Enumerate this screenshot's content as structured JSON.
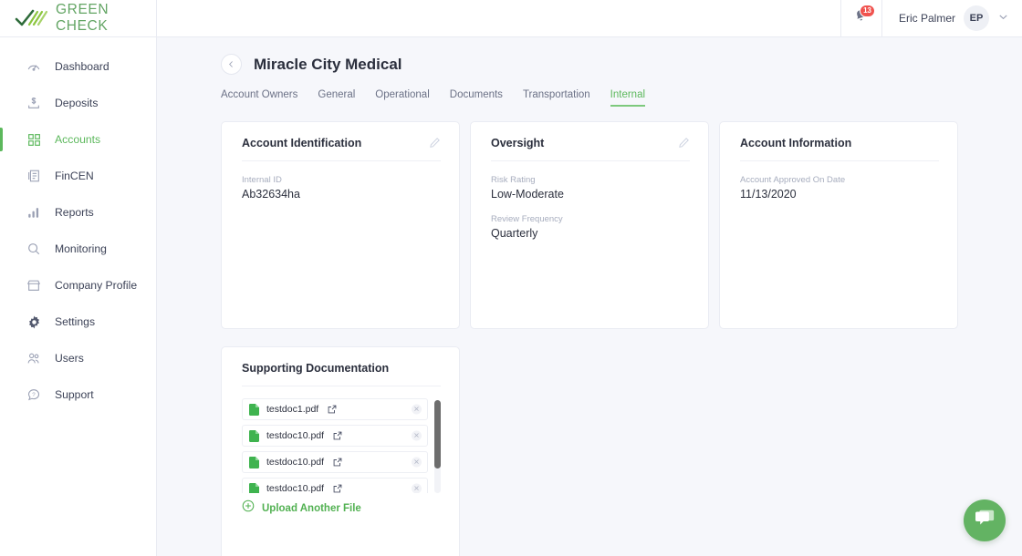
{
  "brand": {
    "name": "GREEN CHECK",
    "color": "#63a564",
    "accent": "#5cb85c"
  },
  "sidebar": {
    "items": [
      {
        "label": "Dashboard",
        "icon": "gauge-icon",
        "active": false
      },
      {
        "label": "Deposits",
        "icon": "dollar-deposit-icon",
        "active": false
      },
      {
        "label": "Accounts",
        "icon": "grid-squares-icon",
        "active": true
      },
      {
        "label": "FinCEN",
        "icon": "document-list-icon",
        "active": false
      },
      {
        "label": "Reports",
        "icon": "bar-chart-icon",
        "active": false
      },
      {
        "label": "Monitoring",
        "icon": "magnifier-icon",
        "active": false
      },
      {
        "label": "Company Profile",
        "icon": "storefront-icon",
        "active": false
      },
      {
        "label": "Settings",
        "icon": "gear-icon",
        "active": false
      },
      {
        "label": "Users",
        "icon": "people-icon",
        "active": false
      },
      {
        "label": "Support",
        "icon": "question-bubble-icon",
        "active": false
      }
    ]
  },
  "topbar": {
    "notifications_count": "13",
    "user_name": "Eric Palmer",
    "user_initials": "EP",
    "badge_color": "#f0534f"
  },
  "page": {
    "title": "Miracle City Medical",
    "back_label": "‹",
    "tabs": [
      {
        "label": "Account Owners",
        "active": false
      },
      {
        "label": "General",
        "active": false
      },
      {
        "label": "Operational",
        "active": false
      },
      {
        "label": "Documents",
        "active": false
      },
      {
        "label": "Transportation",
        "active": false
      },
      {
        "label": "Internal",
        "active": true
      }
    ]
  },
  "cards": [
    {
      "title": "Account Identification",
      "editable": true,
      "fields": [
        {
          "label": "Internal ID",
          "value": "Ab32634ha"
        }
      ]
    },
    {
      "title": "Oversight",
      "editable": true,
      "fields": [
        {
          "label": "Risk Rating",
          "value": "Low-Moderate"
        },
        {
          "label": "Review Frequency",
          "value": "Quarterly"
        }
      ]
    },
    {
      "title": "Account Information",
      "editable": false,
      "fields": [
        {
          "label": "Account Approved On Date",
          "value": "11/13/2020"
        }
      ]
    }
  ],
  "documents": {
    "title": "Supporting Documentation",
    "files": [
      {
        "name": "testdoc1.pdf"
      },
      {
        "name": "testdoc10.pdf"
      },
      {
        "name": "testdoc10.pdf"
      },
      {
        "name": "testdoc10.pdf"
      }
    ],
    "upload_label": "Upload Another File",
    "upload_color": "#52b152"
  },
  "chat": {
    "label": "chat-widget",
    "color": "#63b363"
  }
}
